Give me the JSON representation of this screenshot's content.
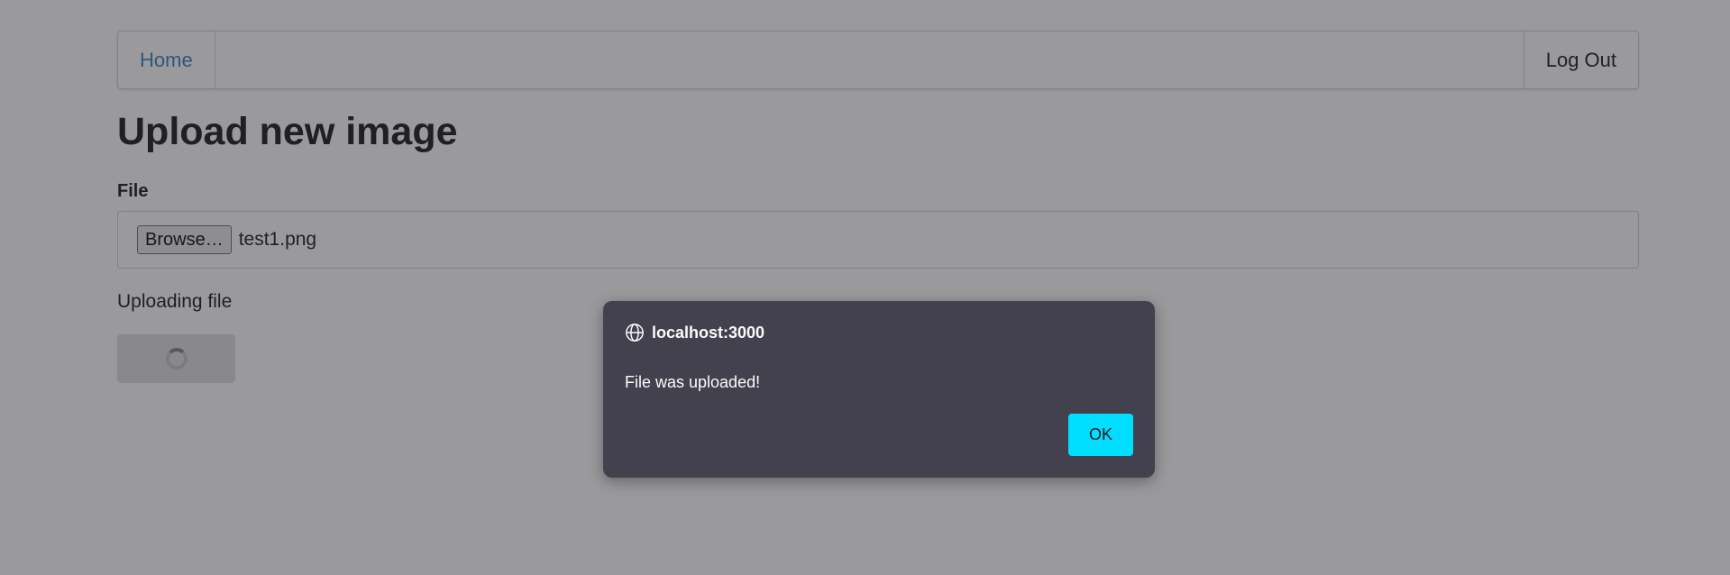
{
  "navbar": {
    "home_label": "Home",
    "logout_label": "Log Out"
  },
  "main": {
    "title": "Upload new image",
    "file_label": "File",
    "browse_label": "Browse…",
    "file_name": "test1.png",
    "status_text": "Uploading file"
  },
  "dialog": {
    "origin": "localhost:3000",
    "message": "File was uploaded!",
    "ok_label": "OK",
    "icon": "globe-icon"
  },
  "colors": {
    "link": "#4183c4",
    "dialog_bg": "#42414d",
    "ok_button": "#00ddff"
  }
}
